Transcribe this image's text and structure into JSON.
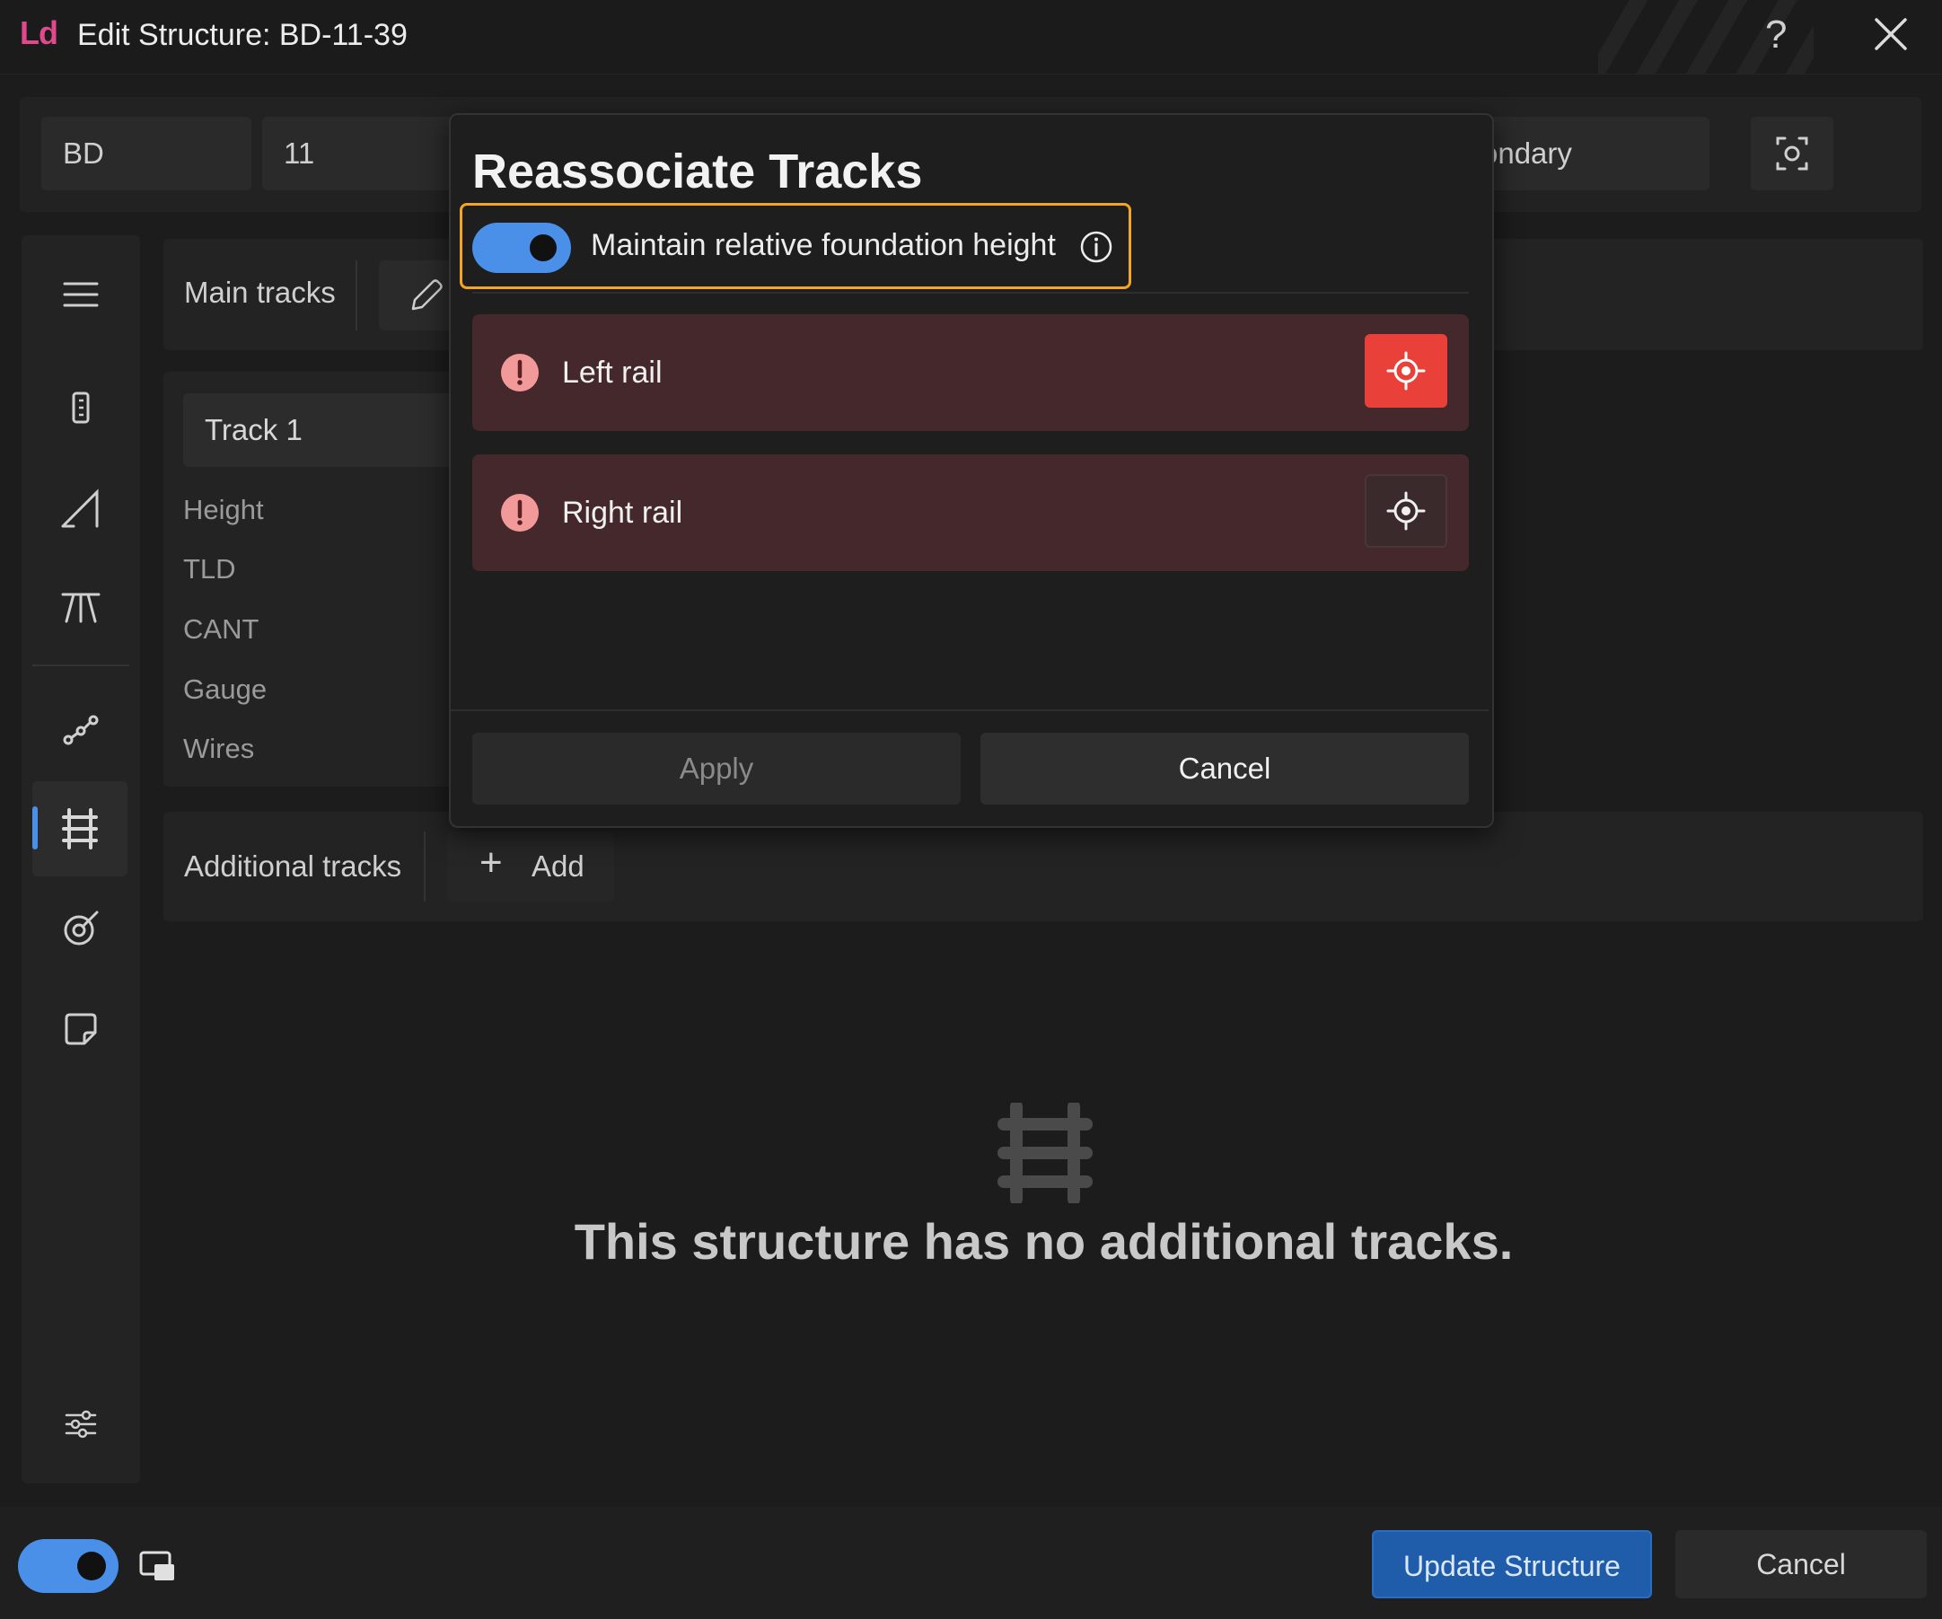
{
  "window": {
    "logo": "Ld",
    "title": "Edit Structure: BD-11-39",
    "help_icon": "?",
    "close_icon": "close-icon"
  },
  "header_fields": {
    "prefix": "BD",
    "number": "11",
    "type_partial": "ondary"
  },
  "sidebar": {
    "items": [
      {
        "icon": "menu-icon"
      },
      {
        "icon": "ruler-icon"
      },
      {
        "icon": "slope-icon"
      },
      {
        "icon": "structure-icon"
      },
      {
        "icon": "route-icon"
      },
      {
        "icon": "tracks-icon",
        "active": true
      },
      {
        "icon": "tag-icon"
      },
      {
        "icon": "note-icon"
      },
      {
        "icon": "sliders-icon"
      }
    ]
  },
  "main_tracks": {
    "label": "Main tracks",
    "track_tab": "Track 1",
    "properties": [
      "Height",
      "TLD",
      "CANT",
      "Gauge",
      "Wires"
    ]
  },
  "additional_tracks": {
    "label": "Additional tracks",
    "add_label": "Add",
    "empty_message": "This structure has no additional tracks."
  },
  "modal": {
    "title": "Reassociate Tracks",
    "toggle_label": "Maintain relative foundation height",
    "toggle_on": true,
    "rails": [
      {
        "label": "Left rail",
        "selected": true
      },
      {
        "label": "Right rail",
        "selected": false
      }
    ],
    "apply_label": "Apply",
    "cancel_label": "Cancel"
  },
  "footer": {
    "toggle_on": true,
    "update_label": "Update Structure",
    "cancel_label": "Cancel"
  },
  "colors": {
    "accent": "#4a8fe8",
    "highlight": "#f2a623",
    "error": "#e9403a",
    "rail_bg": "#45282b"
  }
}
